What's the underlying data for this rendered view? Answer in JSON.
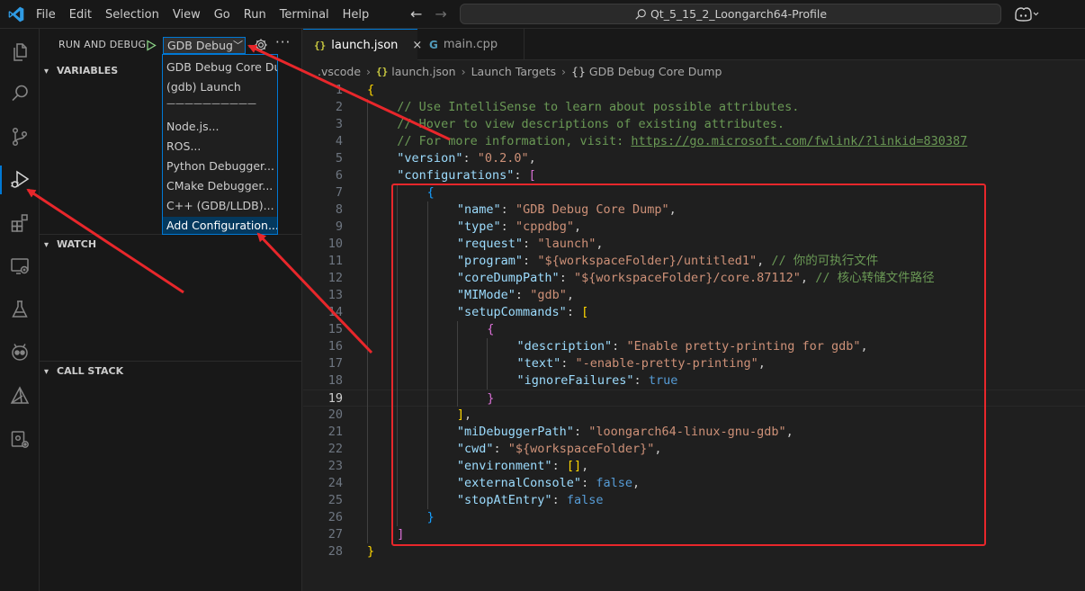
{
  "menu": [
    "File",
    "Edit",
    "Selection",
    "View",
    "Go",
    "Run",
    "Terminal",
    "Help"
  ],
  "title": "Qt_5_15_2_Loongarch64-Profile",
  "sidebar": {
    "title": "RUN AND DEBUG",
    "selected_config": "GDB Debug",
    "more": "···",
    "sections": {
      "variables": "VARIABLES",
      "watch": "WATCH",
      "call_stack": "CALL STACK"
    }
  },
  "dropdown": {
    "items": [
      "GDB Debug Core Dump",
      "(gdb) Launch",
      "Node.js...",
      "ROS...",
      "Python Debugger...",
      "CMake Debugger...",
      "C++ (GDB/LLDB)...",
      "Add Configuration..."
    ],
    "separator": "——————————"
  },
  "tabs": [
    {
      "label": "launch.json",
      "icon": "{}",
      "close": "×"
    },
    {
      "label": "main.cpp",
      "icon": "G"
    }
  ],
  "breadcrumb": [
    ".vscode",
    "launch.json",
    "Launch Targets",
    "GDB Debug Core Dump"
  ],
  "breadcrumb_icons": {
    "json": "{}",
    "object": "{}"
  },
  "editor": {
    "current_line": 19,
    "lines": [
      {
        "n": "1",
        "i": 0,
        "t": [
          [
            "{",
            "t-brace1"
          ]
        ]
      },
      {
        "n": "2",
        "i": 1,
        "t": [
          [
            "// Use IntelliSense to learn about possible attributes.",
            "t-cmt"
          ]
        ]
      },
      {
        "n": "3",
        "i": 1,
        "t": [
          [
            "// Hover to view descriptions of existing attributes.",
            "t-cmt"
          ]
        ]
      },
      {
        "n": "4",
        "i": 1,
        "t": [
          [
            "// For more information, visit: ",
            "t-cmt"
          ],
          [
            "https://go.microsoft.com/fwlink/?linkid=830387",
            "t-link"
          ]
        ]
      },
      {
        "n": "5",
        "i": 1,
        "t": [
          [
            "\"version\"",
            "t-key"
          ],
          [
            ": ",
            "t-punc"
          ],
          [
            "\"0.2.0\"",
            "t-str"
          ],
          [
            ",",
            "t-punc"
          ]
        ]
      },
      {
        "n": "6",
        "i": 1,
        "t": [
          [
            "\"configurations\"",
            "t-key"
          ],
          [
            ": ",
            "t-punc"
          ],
          [
            "[",
            "t-brace2"
          ]
        ]
      },
      {
        "n": "7",
        "i": 2,
        "t": [
          [
            "{",
            "t-brace3"
          ]
        ]
      },
      {
        "n": "8",
        "i": 3,
        "t": [
          [
            "\"name\"",
            "t-key"
          ],
          [
            ": ",
            "t-punc"
          ],
          [
            "\"GDB Debug Core Dump\"",
            "t-str"
          ],
          [
            ",",
            "t-punc"
          ]
        ]
      },
      {
        "n": "9",
        "i": 3,
        "t": [
          [
            "\"type\"",
            "t-key"
          ],
          [
            ": ",
            "t-punc"
          ],
          [
            "\"cppdbg\"",
            "t-str"
          ],
          [
            ",",
            "t-punc"
          ]
        ]
      },
      {
        "n": "10",
        "i": 3,
        "t": [
          [
            "\"request\"",
            "t-key"
          ],
          [
            ": ",
            "t-punc"
          ],
          [
            "\"launch\"",
            "t-str"
          ],
          [
            ",",
            "t-punc"
          ]
        ]
      },
      {
        "n": "11",
        "i": 3,
        "t": [
          [
            "\"program\"",
            "t-key"
          ],
          [
            ": ",
            "t-punc"
          ],
          [
            "\"${workspaceFolder}/untitled1\"",
            "t-str"
          ],
          [
            ", ",
            "t-punc"
          ],
          [
            "// 你的可执行文件",
            "t-cmt"
          ]
        ]
      },
      {
        "n": "12",
        "i": 3,
        "t": [
          [
            "\"coreDumpPath\"",
            "t-key"
          ],
          [
            ": ",
            "t-punc"
          ],
          [
            "\"${workspaceFolder}/core.87112\"",
            "t-str"
          ],
          [
            ", ",
            "t-punc"
          ],
          [
            "// 核心转储文件路径",
            "t-cmt"
          ]
        ]
      },
      {
        "n": "13",
        "i": 3,
        "t": [
          [
            "\"MIMode\"",
            "t-key"
          ],
          [
            ": ",
            "t-punc"
          ],
          [
            "\"gdb\"",
            "t-str"
          ],
          [
            ",",
            "t-punc"
          ]
        ]
      },
      {
        "n": "14",
        "i": 3,
        "t": [
          [
            "\"setupCommands\"",
            "t-key"
          ],
          [
            ": ",
            "t-punc"
          ],
          [
            "[",
            "t-brace1"
          ]
        ]
      },
      {
        "n": "15",
        "i": 4,
        "t": [
          [
            "{",
            "t-brace2"
          ]
        ]
      },
      {
        "n": "16",
        "i": 5,
        "t": [
          [
            "\"description\"",
            "t-key"
          ],
          [
            ": ",
            "t-punc"
          ],
          [
            "\"Enable pretty-printing for gdb\"",
            "t-str"
          ],
          [
            ",",
            "t-punc"
          ]
        ]
      },
      {
        "n": "17",
        "i": 5,
        "t": [
          [
            "\"text\"",
            "t-key"
          ],
          [
            ": ",
            "t-punc"
          ],
          [
            "\"-enable-pretty-printing\"",
            "t-str"
          ],
          [
            ",",
            "t-punc"
          ]
        ]
      },
      {
        "n": "18",
        "i": 5,
        "t": [
          [
            "\"ignoreFailures\"",
            "t-key"
          ],
          [
            ": ",
            "t-punc"
          ],
          [
            "true",
            "t-bool"
          ]
        ]
      },
      {
        "n": "19",
        "i": 4,
        "t": [
          [
            "}",
            "t-brace2"
          ]
        ]
      },
      {
        "n": "20",
        "i": 3,
        "t": [
          [
            "]",
            "t-brace1"
          ],
          [
            ",",
            "t-punc"
          ]
        ]
      },
      {
        "n": "21",
        "i": 3,
        "t": [
          [
            "\"miDebuggerPath\"",
            "t-key"
          ],
          [
            ": ",
            "t-punc"
          ],
          [
            "\"loongarch64-linux-gnu-gdb\"",
            "t-str"
          ],
          [
            ",",
            "t-punc"
          ]
        ]
      },
      {
        "n": "22",
        "i": 3,
        "t": [
          [
            "\"cwd\"",
            "t-key"
          ],
          [
            ": ",
            "t-punc"
          ],
          [
            "\"${workspaceFolder}\"",
            "t-str"
          ],
          [
            ",",
            "t-punc"
          ]
        ]
      },
      {
        "n": "23",
        "i": 3,
        "t": [
          [
            "\"environment\"",
            "t-key"
          ],
          [
            ": ",
            "t-punc"
          ],
          [
            "[]",
            "t-brace1"
          ],
          [
            ",",
            "t-punc"
          ]
        ]
      },
      {
        "n": "24",
        "i": 3,
        "t": [
          [
            "\"externalConsole\"",
            "t-key"
          ],
          [
            ": ",
            "t-punc"
          ],
          [
            "false",
            "t-bool"
          ],
          [
            ",",
            "t-punc"
          ]
        ]
      },
      {
        "n": "25",
        "i": 3,
        "t": [
          [
            "\"stopAtEntry\"",
            "t-key"
          ],
          [
            ": ",
            "t-punc"
          ],
          [
            "false",
            "t-bool"
          ]
        ]
      },
      {
        "n": "26",
        "i": 2,
        "t": [
          [
            "}",
            "t-brace3"
          ]
        ]
      },
      {
        "n": "27",
        "i": 1,
        "t": [
          [
            "]",
            "t-brace2"
          ]
        ]
      },
      {
        "n": "28",
        "i": 0,
        "t": [
          [
            "}",
            "t-brace1"
          ]
        ]
      }
    ]
  },
  "colors": {
    "accent": "#0078d4",
    "annotation": "#e8272b"
  }
}
